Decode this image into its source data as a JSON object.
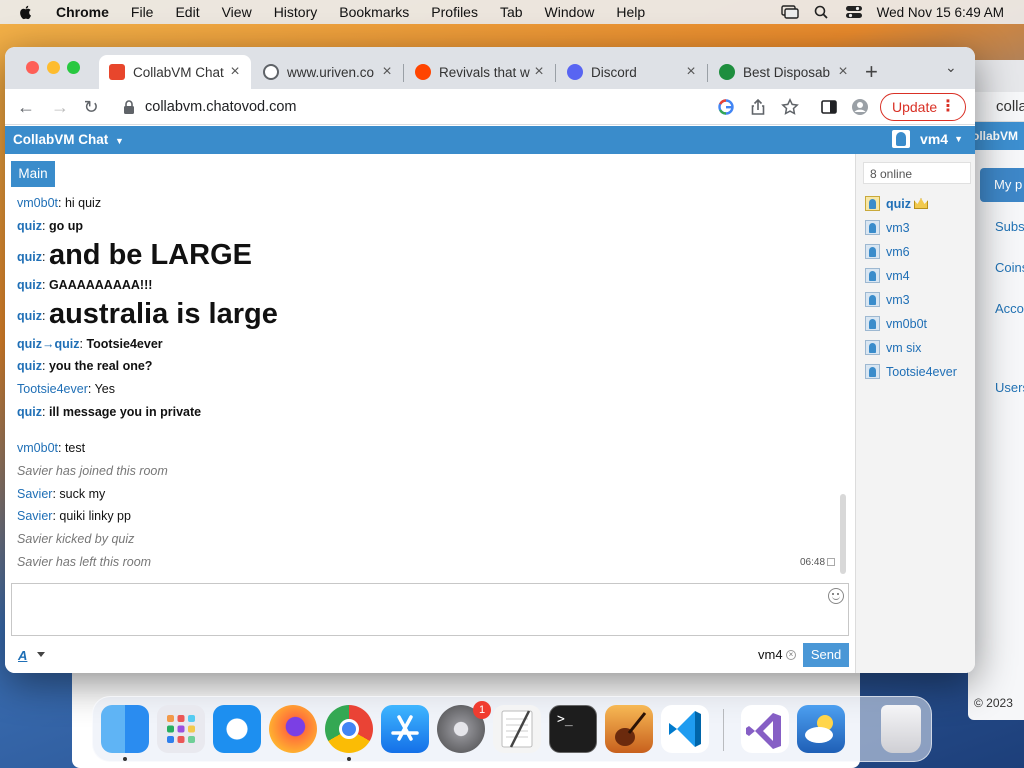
{
  "menubar": {
    "app_name": "Chrome",
    "menus": [
      "File",
      "Edit",
      "View",
      "History",
      "Bookmarks",
      "Profiles",
      "Tab",
      "Window",
      "Help"
    ],
    "clock": "Wed Nov 15  6:49 AM"
  },
  "browser": {
    "tabs": [
      {
        "title": "CollabVM Chat",
        "active": true,
        "favicon_color": "#e8462c"
      },
      {
        "title": "www.uriven.co",
        "active": false,
        "favicon_color": "#5f6368"
      },
      {
        "title": "Revivals that w",
        "active": false,
        "favicon_color": "#ff4500"
      },
      {
        "title": "Discord",
        "active": false,
        "favicon_color": "#5865f2"
      },
      {
        "title": "Best Disposab",
        "active": false,
        "favicon_color": "#1e8e3e"
      }
    ],
    "url": "collabvm.chatovod.com",
    "update_label": "Update"
  },
  "chat": {
    "brand": "CollabVM Chat",
    "current_user": "vm4",
    "room_tab": "Main",
    "messages": [
      {
        "nick": "vm0b0t",
        "text": "hi quiz",
        "type": "normal"
      },
      {
        "nick": "quiz",
        "text": "go up",
        "type": "bold"
      },
      {
        "nick": "quiz",
        "text": "and be LARGE",
        "type": "big"
      },
      {
        "nick": "quiz",
        "text": "GAAAAAAAAA!!!",
        "type": "bold"
      },
      {
        "nick": "quiz",
        "text": "australia is large",
        "type": "big"
      },
      {
        "nick": "quiz",
        "to": "quiz",
        "text": "Tootsie4ever",
        "type": "private"
      },
      {
        "nick": "quiz",
        "text": "you the real one?",
        "type": "bold"
      },
      {
        "nick": "Tootsie4ever",
        "text": "Yes",
        "type": "normal"
      },
      {
        "nick": "quiz",
        "text": "ill message you in private",
        "type": "bold"
      },
      {
        "nick": "vm0b0t",
        "text": "test",
        "type": "normal"
      },
      {
        "text": "Savier has joined this room",
        "type": "system"
      },
      {
        "nick": "Savier",
        "text": "suck my",
        "type": "normal"
      },
      {
        "nick": "Savier",
        "text": "quiki linky pp",
        "type": "normal"
      },
      {
        "text": "Savier kicked by quiz",
        "type": "system"
      },
      {
        "text": "Savier has left this room",
        "type": "system"
      }
    ],
    "last_timestamp": "06:48",
    "format_button": "A",
    "alias": "vm4",
    "send_label": "Send",
    "online_count": "8 online",
    "users": [
      {
        "name": "quiz",
        "owner": true
      },
      {
        "name": "vm3",
        "owner": false
      },
      {
        "name": "vm6",
        "owner": false
      },
      {
        "name": "vm4",
        "owner": false
      },
      {
        "name": "vm3",
        "owner": false
      },
      {
        "name": "vm0b0t",
        "owner": false
      },
      {
        "name": "vm six",
        "owner": false
      },
      {
        "name": "Tootsie4ever",
        "owner": false
      }
    ]
  },
  "background_window": {
    "url_partial": "colla",
    "header_partial": "ollabVM",
    "button_partial": "My p",
    "links": [
      "Subs",
      "Coins",
      "Acco",
      "Users"
    ],
    "footer_partial": "© 2023"
  },
  "dock": {
    "apps": [
      {
        "name": "finder-icon",
        "color": "#2a8cf0",
        "running": true
      },
      {
        "name": "launchpad-icon",
        "color": "#e9e9ef",
        "running": false
      },
      {
        "name": "safari-icon",
        "color": "#1d8ff0",
        "running": false
      },
      {
        "name": "firefox-icon",
        "color": "#ff7139",
        "running": false
      },
      {
        "name": "chrome-icon",
        "color": "#ffffff",
        "running": true
      },
      {
        "name": "app-store-icon",
        "color": "#1a9cf8",
        "running": false
      },
      {
        "name": "system-settings-icon",
        "color": "#8e8e93",
        "running": false,
        "badge": "1"
      },
      {
        "name": "textedit-icon",
        "color": "#f4f4f4",
        "running": false
      },
      {
        "name": "terminal-icon",
        "color": "#1d1d1d",
        "running": false
      },
      {
        "name": "garageband-icon",
        "color": "#f09a2c",
        "running": false
      },
      {
        "name": "vscode-icon",
        "color": "#ffffff",
        "running": false
      },
      {
        "name": "visual-studio-icon",
        "color": "#ffffff",
        "running": false
      },
      {
        "name": "weather-icon",
        "color": "#2f7fd9",
        "running": false
      },
      {
        "name": "trash-icon",
        "color": "#e8e8ea",
        "running": false
      }
    ]
  }
}
